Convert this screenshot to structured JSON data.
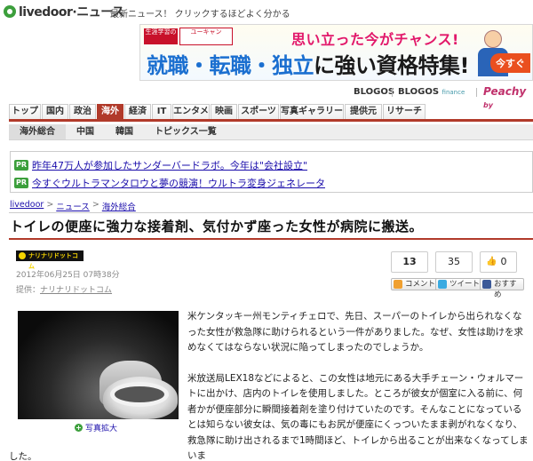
{
  "header": {
    "logo_text": "livedoor·ニュース",
    "tagline": "最新ニュース！ クリックするほどよく分かる"
  },
  "banner": {
    "badge_text": "生涯学習の",
    "brand_text": "ユーキャン",
    "line1": "思い立った今がチャンス!",
    "line2_a": "就職・転職・独立",
    "line2_b": "に強い資格特集!",
    "cta": "今すぐ"
  },
  "brands": {
    "blogos": "BLOGOS",
    "blogos_finance": "BLOGOS",
    "blogos_finance_small": "finance",
    "peachy": "Peachy",
    "peachy_suffix": "by"
  },
  "nav_main": [
    {
      "label": "トップ",
      "w": 36
    },
    {
      "label": "国内",
      "w": 30
    },
    {
      "label": "政治",
      "w": 30
    },
    {
      "label": "海外",
      "w": 30,
      "active": true
    },
    {
      "label": "経済",
      "w": 30
    },
    {
      "label": "IT",
      "w": 22
    },
    {
      "label": "エンタメ",
      "w": 42
    },
    {
      "label": "映画",
      "w": 30
    },
    {
      "label": "スポーツ",
      "w": 46
    },
    {
      "label": "写真ギャラリー",
      "w": 72
    },
    {
      "label": "提供元",
      "w": 42
    },
    {
      "label": "リサーチ",
      "w": 48
    }
  ],
  "nav_sub": [
    {
      "label": "海外総合",
      "active": true
    },
    {
      "label": "中国"
    },
    {
      "label": "韓国"
    },
    {
      "label": "トピックス一覧"
    }
  ],
  "pr": {
    "tag": "PR",
    "link1": "昨年47万人が参加したサンダーバードラボ。今年は\"会社設立\"",
    "link2": "今すぐウルトラマンタロウと夢の競演！ウルトラ変身ジェネレータ"
  },
  "breadcrumb": {
    "home": "livedoor",
    "news": "ニュース",
    "section": "海外総合",
    "arrow": ">"
  },
  "article": {
    "title": "トイレの便座に強力な接着剤、気付かず座った女性が病院に搬送。",
    "source_logo": "ナリナリドットコム",
    "date": "2012年06月25日 07時38分",
    "provider_label": "提供：",
    "provider": "ナリナリドットコム",
    "photo_caption": "写真拡大",
    "para1": "米ケンタッキー州モンティチェロで、先日、スーパーのトイレから出られなくなった女性が救急隊に助けられるという一件がありました。なぜ、女性は助けを求めなくてはならない状況に陥ってしまったのでしょうか。",
    "para2": "米放送局LEX18などによると、この女性は地元にある大手チェーン・ウォルマートに出かけ、店内のトイレを使用しました。ところが彼女が個室に入る前に、何者かが便座部分に瞬間接着剤を塗り付けていたのです。そんなことになっているとは知らない彼女は、気の毒にもお尻が便座にくっついたまま剥がれなくなり、救急隊に助け出されるまで1時間ほど、トイレから出ることが出来なくなってしまいま",
    "para2_tail": "した。"
  },
  "share": {
    "count1": "13",
    "count2": "35",
    "count3": "0",
    "comment_label": "コメント",
    "tweet_label": "ツイート",
    "recommend_label": "おすすめ"
  }
}
